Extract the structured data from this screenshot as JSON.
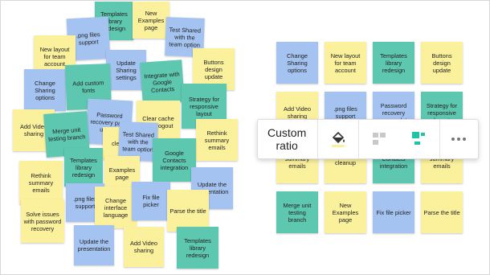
{
  "colors": {
    "yellow": "#fbf19d",
    "blue": "#a5c3f1",
    "teal": "#5ec7b0",
    "toolbar_accent": "#1bc5a6"
  },
  "toolbar": {
    "ratio_label_line1": "Custom",
    "ratio_label_line2": "ratio",
    "icons": [
      "fill-color-icon",
      "layout-grid-icon",
      "layout-arrange-icon",
      "more-icon"
    ]
  },
  "left_cluster": [
    {
      "text": "Templates library redesign",
      "color": "teal"
    },
    {
      "text": "New Examples page",
      "color": "yellow"
    },
    {
      "text": ".png files support",
      "color": "blue"
    },
    {
      "text": "Test Shared with the team option",
      "color": "blue"
    },
    {
      "text": "New layout for team account",
      "color": "yellow"
    },
    {
      "text": "Update Sharing settings",
      "color": "blue"
    },
    {
      "text": "Buttons design update",
      "color": "yellow"
    },
    {
      "text": "Change Sharing options",
      "color": "blue"
    },
    {
      "text": "Add custom fonts",
      "color": "teal"
    },
    {
      "text": "Integrate with Google Contacts",
      "color": "teal"
    },
    {
      "text": "Strategy for responsive layout",
      "color": "teal"
    },
    {
      "text": "Password recovery page update",
      "color": "blue"
    },
    {
      "text": "Clear cache after logout",
      "color": "yellow"
    },
    {
      "text": "Add Video sharing",
      "color": "yellow"
    },
    {
      "text": "Merge unit testing branch",
      "color": "teal"
    },
    {
      "text": "Rethink summary emails",
      "color": "yellow"
    },
    {
      "text": "clean",
      "color": "yellow"
    },
    {
      "text": "Test Shared with the team option",
      "color": "blue"
    },
    {
      "text": "Google Contacts integration",
      "color": "teal"
    },
    {
      "text": "Templates library redesign",
      "color": "teal"
    },
    {
      "text": "Examples page",
      "color": "yellow"
    },
    {
      "text": "Rethink summary emails",
      "color": "yellow"
    },
    {
      "text": "Update the presentation",
      "color": "blue"
    },
    {
      "text": ".png files support",
      "color": "blue"
    },
    {
      "text": "Change interface language",
      "color": "yellow"
    },
    {
      "text": "Fix file picker",
      "color": "blue"
    },
    {
      "text": "Parse the title",
      "color": "yellow"
    },
    {
      "text": "Solve issues with password recovery",
      "color": "yellow"
    },
    {
      "text": "Update the presentation",
      "color": "blue"
    },
    {
      "text": "Add Video sharing",
      "color": "yellow"
    },
    {
      "text": "Templates library redesign",
      "color": "teal"
    }
  ],
  "grid": [
    {
      "text": "Change Sharing options",
      "color": "blue"
    },
    {
      "text": "New layout for team account",
      "color": "yellow"
    },
    {
      "text": "Templates library redesign",
      "color": "teal"
    },
    {
      "text": "Buttons design update",
      "color": "yellow"
    },
    {
      "text": "Add Video sharing",
      "color": "yellow"
    },
    {
      "text": ".png files support",
      "color": "blue"
    },
    {
      "text": "Password recovery page update",
      "color": "blue"
    },
    {
      "text": "Strategy for responsive layout",
      "color": "teal"
    },
    {
      "text": "summary emails",
      "color": "yellow"
    },
    {
      "text": "cleanup",
      "color": "yellow"
    },
    {
      "text": "Contacts integration",
      "color": "teal"
    },
    {
      "text": "summary emails",
      "color": "yellow"
    },
    {
      "text": "Merge unit testing branch",
      "color": "teal"
    },
    {
      "text": "New Examples page",
      "color": "yellow"
    },
    {
      "text": "Fix file picker",
      "color": "blue"
    },
    {
      "text": "Parse the title",
      "color": "yellow"
    }
  ]
}
